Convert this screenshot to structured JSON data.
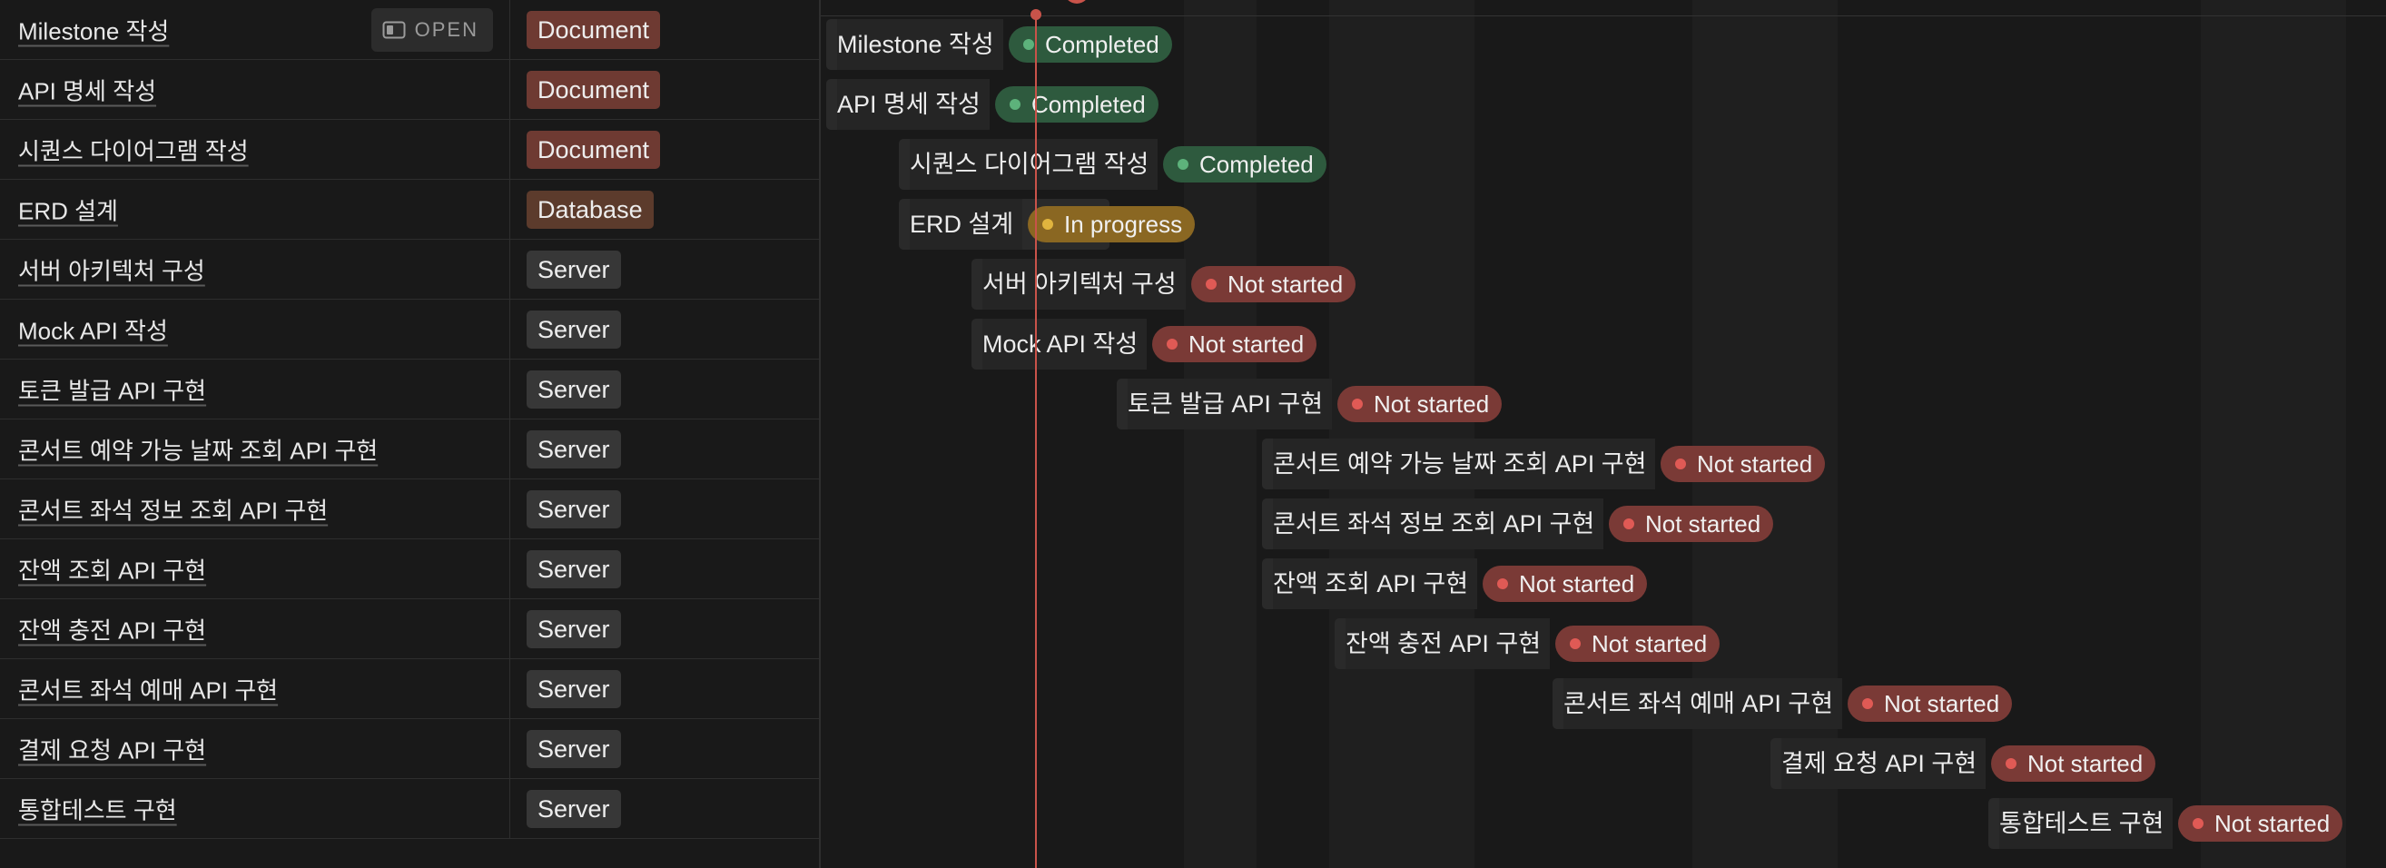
{
  "colors": {
    "document_tag": "#6e3a32",
    "database_tag": "#5c3b2c",
    "server_tag": "#373737",
    "completed_bg": "#2e5a3e",
    "completed_dot": "#5db27b",
    "in_progress_bg": "#8a6722",
    "in_progress_dot": "#e0b43e",
    "not_started_bg": "#7a3a36",
    "not_started_dot": "#e05a55",
    "today_line": "#c9534a"
  },
  "open_button": {
    "label": "OPEN",
    "icon": "side-peek-icon"
  },
  "rows": [
    {
      "name": "Milestone 작성",
      "tag": "Document",
      "tag_type": "document",
      "status": "Completed",
      "status_type": "completed"
    },
    {
      "name": "API 명세 작성",
      "tag": "Document",
      "tag_type": "document",
      "status": "Completed",
      "status_type": "completed"
    },
    {
      "name": "시퀀스 다이어그램 작성",
      "tag": "Document",
      "tag_type": "document",
      "status": "Completed",
      "status_type": "completed"
    },
    {
      "name": "ERD 설계",
      "tag": "Database",
      "tag_type": "database",
      "status": "In progress",
      "status_type": "in_progress"
    },
    {
      "name": "서버 아키텍처 구성",
      "tag": "Server",
      "tag_type": "server",
      "status": "Not started",
      "status_type": "not_started"
    },
    {
      "name": "Mock API 작성",
      "tag": "Server",
      "tag_type": "server",
      "status": "Not started",
      "status_type": "not_started"
    },
    {
      "name": "토큰 발급 API 구현",
      "tag": "Server",
      "tag_type": "server",
      "status": "Not started",
      "status_type": "not_started"
    },
    {
      "name": "콘서트 예약 가능 날짜 조회 API 구현",
      "tag": "Server",
      "tag_type": "server",
      "status": "Not started",
      "status_type": "not_started"
    },
    {
      "name": "콘서트 좌석 정보 조회 API 구현",
      "tag": "Server",
      "tag_type": "server",
      "status": "Not started",
      "status_type": "not_started"
    },
    {
      "name": "잔액 조회 API 구현",
      "tag": "Server",
      "tag_type": "server",
      "status": "Not started",
      "status_type": "not_started"
    },
    {
      "name": "잔액 충전 API 구현",
      "tag": "Server",
      "tag_type": "server",
      "status": "Not started",
      "status_type": "not_started"
    },
    {
      "name": "콘서트 좌석 예매 API 구현",
      "tag": "Server",
      "tag_type": "server",
      "status": "Not started",
      "status_type": "not_started"
    },
    {
      "name": "결제 요청 API 구현",
      "tag": "Server",
      "tag_type": "server",
      "status": "Not started",
      "status_type": "not_started"
    },
    {
      "name": "통합테스트 구현",
      "tag": "Server",
      "tag_type": "server",
      "status": "Not started",
      "status_type": "not_started"
    }
  ]
}
